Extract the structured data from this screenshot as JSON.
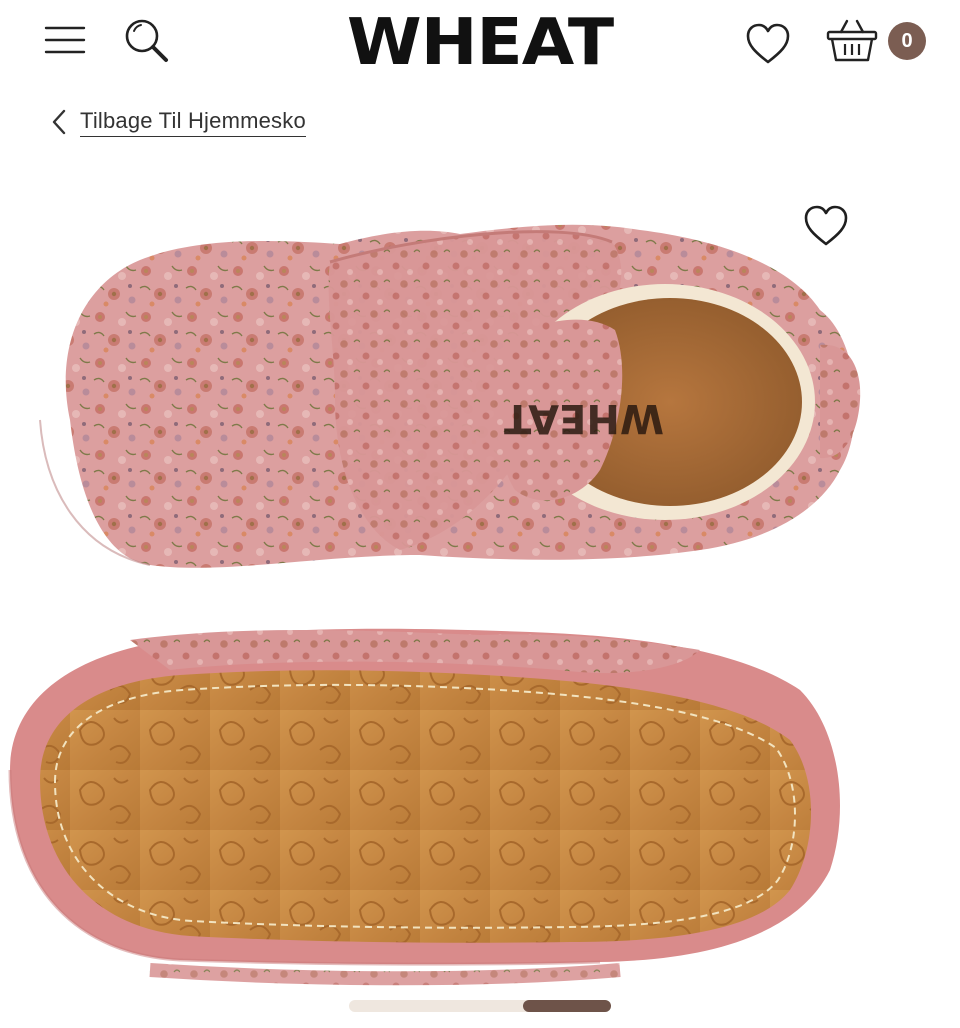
{
  "header": {
    "logo_text": "WHEAT",
    "cart_count": "0",
    "icons": {
      "menu": "hamburger-menu-icon",
      "search": "search-icon",
      "wishlist": "heart-icon",
      "cart": "shopping-basket-icon"
    }
  },
  "breadcrumb": {
    "back_label": "Tilbage Til Hjemmesko"
  },
  "product_image": {
    "insole_brand": "WHEAT",
    "favorite_icon": "heart-icon"
  },
  "carousel": {
    "progress": 0.33
  },
  "colors": {
    "accent_brown": "#7b5d52",
    "progress_active": "#6e5349",
    "progress_track": "#efe7df",
    "shoe_pink": "#d99a9a",
    "sole_tan": "#c98a43"
  }
}
